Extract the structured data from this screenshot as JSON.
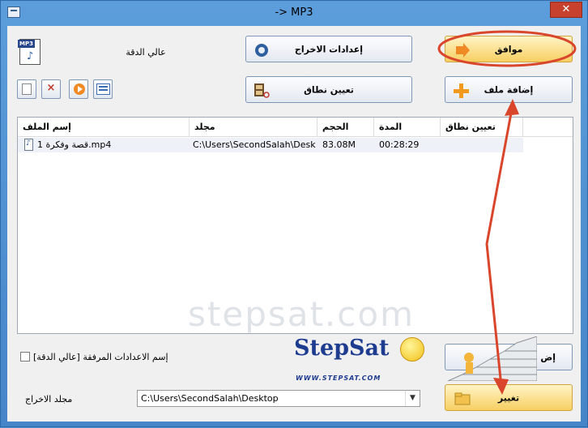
{
  "window": {
    "title": "-> MP3",
    "close_label": "✕"
  },
  "buttons": {
    "ok": "موافق",
    "output_settings": "إعدادات الاخراج",
    "add_file": "إضافة ملف",
    "set_range": "تعيين نطاق",
    "change": "تغيير",
    "hidden_partial": "إض"
  },
  "format": {
    "icon_tag": "MP3",
    "quality": "عالي الدقة"
  },
  "file_list": {
    "columns": [
      "إسم الملف",
      "مجلد",
      "الحجم",
      "المدة",
      "تعيين نطاق"
    ],
    "rows": [
      {
        "name": "قصة وفكرة 1.mp4",
        "folder": "C:\\Users\\SecondSalah\\Desk...",
        "size": "83.08M",
        "duration": "00:28:29",
        "range": ""
      }
    ]
  },
  "watermark": "stepsat.com",
  "preset": {
    "checked": false,
    "label": "إسم الاعدادات المرفقة [عالي الدقة]"
  },
  "output_folder": {
    "label": "مجلد الاخراج",
    "value": "C:\\Users\\SecondSalah\\Desktop"
  },
  "logo": {
    "text": "StepSat",
    "url": "WWW.STEPSAT.COM"
  },
  "colors": {
    "annotation": "#d9462c",
    "accent_button": "#f7cf62",
    "window_frame": "#4d8fcf"
  }
}
